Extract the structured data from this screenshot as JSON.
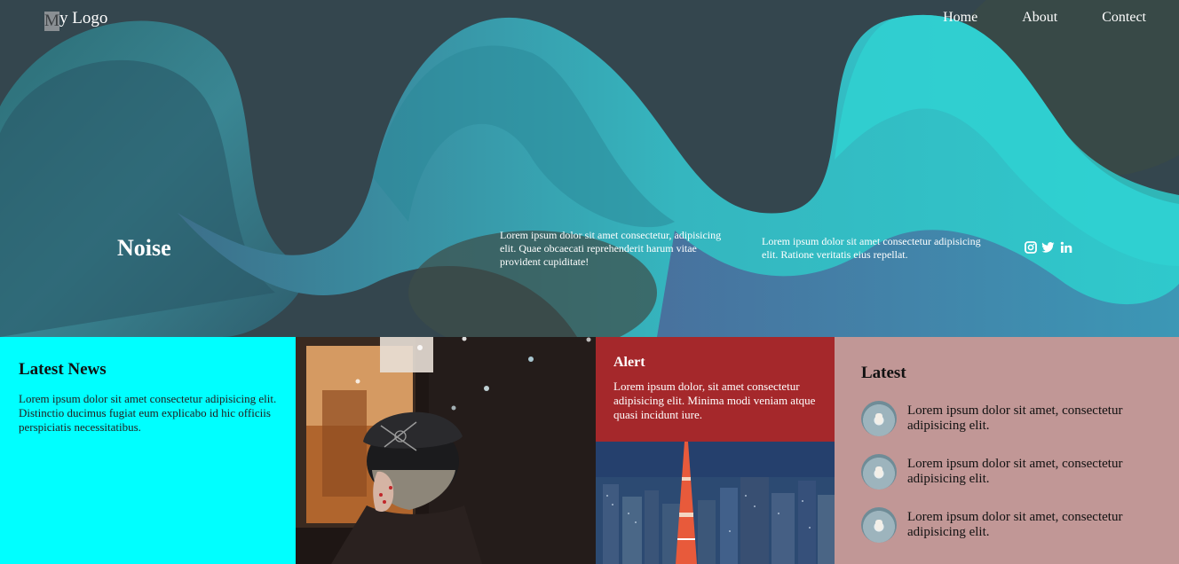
{
  "header": {
    "logo_first": "M",
    "logo_rest": "y Logo",
    "nav": [
      {
        "label": "Home"
      },
      {
        "label": "About"
      },
      {
        "label": "Contect"
      }
    ]
  },
  "hero": {
    "title": "Noise",
    "text1": "Lorem ipsum dolor sit amet consectetur, adipisicing elit. Quae obcaecati reprehenderit harum vitae provident cupiditate!",
    "text2": "Lorem ipsum dolor sit amet consectetur adipisicing elit. Ratione veritatis eius repellat.",
    "social_icons": [
      "instagram-icon",
      "twitter-icon",
      "linkedin-icon"
    ]
  },
  "news": {
    "title": "Latest News",
    "text": "Lorem ipsum dolor sit amet consectetur adipisicing elit. Distinctio ducimus fugiat eum explicabo id hic officiis perspiciatis necessitatibus."
  },
  "alert": {
    "title": "Alert",
    "text": "Lorem ipsum dolor, sit amet consectetur adipisicing elit. Minima modi veniam atque quasi incidunt iure."
  },
  "latest": {
    "title": "Latest",
    "items": [
      {
        "text": "Lorem ipsum dolor sit amet, consectetur adipisicing elit."
      },
      {
        "text": "Lorem ipsum dolor sit amet, consectetur adipisicing elit."
      },
      {
        "text": "Lorem ipsum dolor sit amet, consectetur adipisicing elit."
      }
    ]
  },
  "colors": {
    "news_bg": "#00ffff",
    "alert_bg": "#a5282b",
    "latest_bg": "#c19796",
    "wave_teal": "#2fc6c9"
  }
}
